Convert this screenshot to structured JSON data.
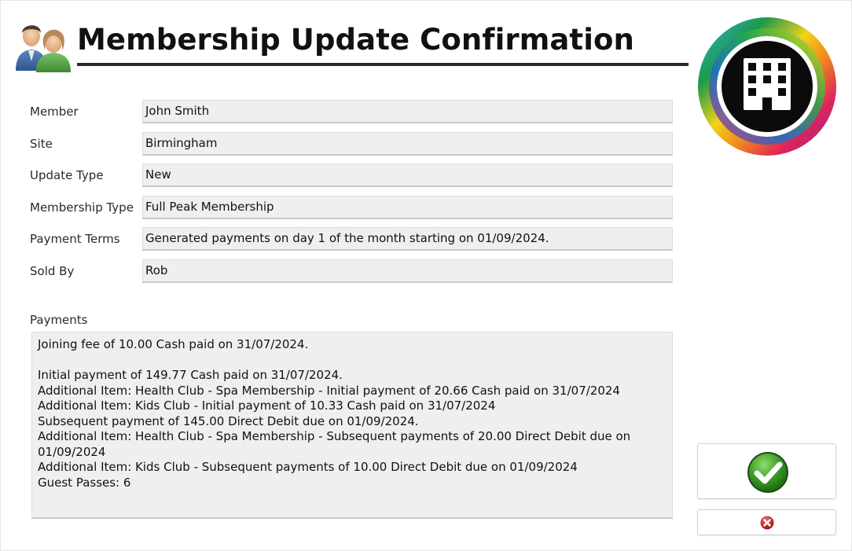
{
  "window": {
    "title": "Membership Update Confirmation"
  },
  "icons": {
    "header": "people-icon",
    "logo": "building-logo",
    "ok": "check-icon",
    "cancel": "close-icon"
  },
  "colors": {
    "ok_green": "#3a9a25",
    "cancel_red": "#c42020",
    "field_bg": "#efefef"
  },
  "fields": {
    "member": {
      "label": "Member",
      "value": "John Smith"
    },
    "site": {
      "label": "Site",
      "value": "Birmingham"
    },
    "update_type": {
      "label": "Update Type",
      "value": "New"
    },
    "membership_type": {
      "label": "Membership Type",
      "value": "Full Peak Membership"
    },
    "payment_terms": {
      "label": "Payment Terms",
      "value": "Generated payments on day 1 of the month starting on 01/09/2024."
    },
    "sold_by": {
      "label": "Sold By",
      "value": "Rob"
    }
  },
  "payments": {
    "label": "Payments",
    "lines": [
      "Joining fee of 10.00 Cash paid on 31/07/2024.",
      "",
      "Initial payment of 149.77 Cash paid on 31/07/2024.",
      "Additional Item: Health Club - Spa Membership - Initial payment of 20.66 Cash paid on 31/07/2024",
      "Additional Item: Kids Club - Initial payment of 10.33 Cash paid on 31/07/2024",
      "Subsequent payment of 145.00 Direct Debit due on 01/09/2024.",
      "Additional Item: Health Club - Spa Membership - Subsequent payments of 20.00 Direct Debit due on",
      "01/09/2024",
      "Additional Item: Kids Club - Subsequent payments of 10.00 Direct Debit due on 01/09/2024",
      "Guest Passes: 6"
    ]
  }
}
